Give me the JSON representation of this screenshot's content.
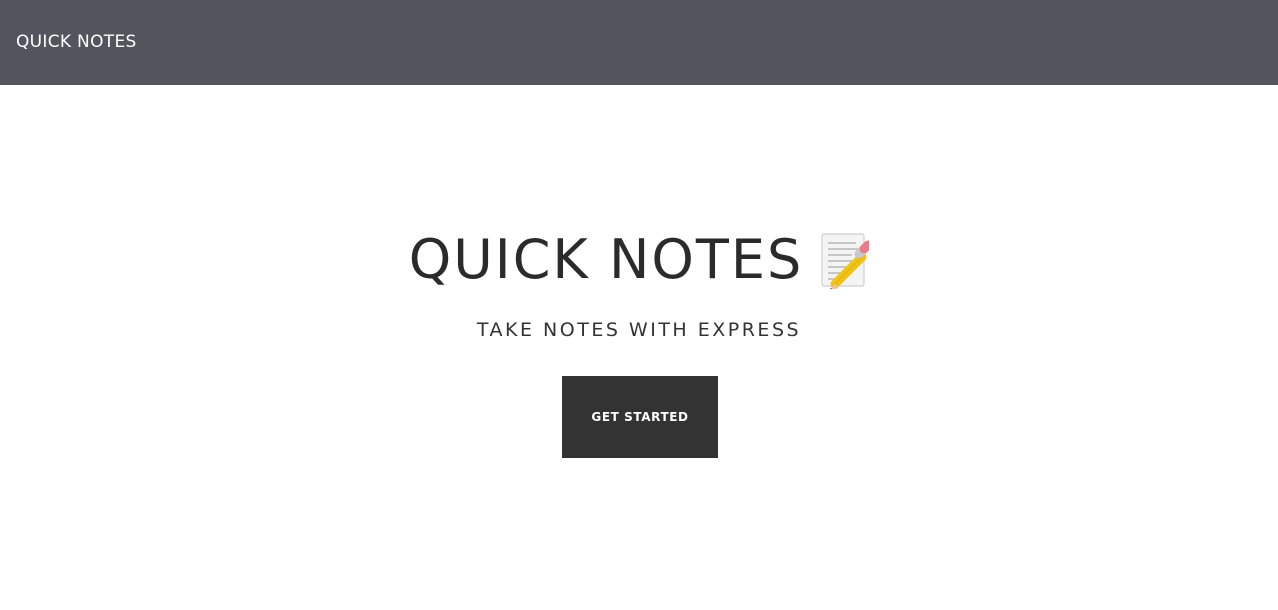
{
  "navbar": {
    "brand": "QUICK NOTES"
  },
  "hero": {
    "title": "QUICK NOTES",
    "title_icon": "memo-pencil-icon",
    "subtitle": "TAKE NOTES WITH EXPRESS",
    "cta_label": "GET STARTED"
  },
  "colors": {
    "navbar_background": "#52555d",
    "button_background": "#333333",
    "text_dark": "#2b2b2b",
    "page_background": "#ffffff"
  }
}
